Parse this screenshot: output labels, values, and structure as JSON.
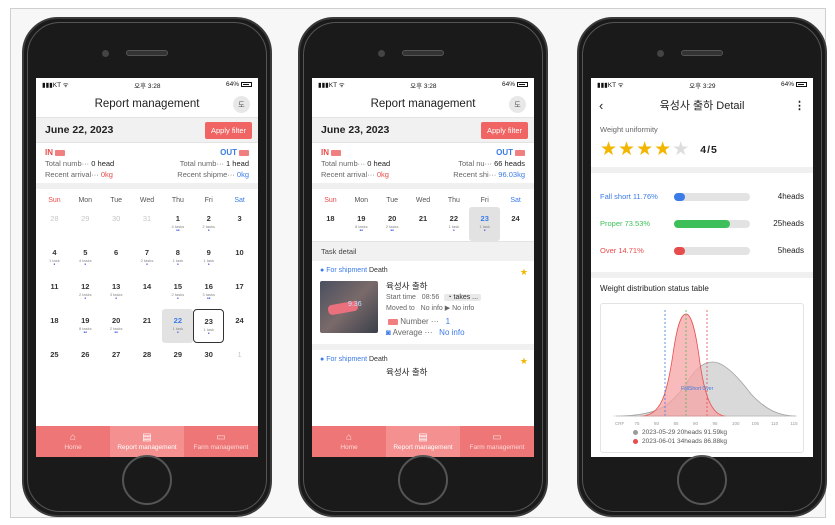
{
  "status": {
    "carrier": "KT",
    "time1": "오후 3:28",
    "time2": "오후 3:28",
    "time3": "오후 3:29",
    "battery": "64%"
  },
  "screen1": {
    "title": "Report management",
    "avatar": "도",
    "date": "June 22, 2023",
    "filter_label": "Apply filter",
    "in_label": "IN",
    "out_label": "OUT",
    "row1_l_label": "Total numb···",
    "row1_l_val": "0 head",
    "row1_r_label": "Total numb···",
    "row1_r_val": "1 head",
    "row2_l_label": "Recent arrival···",
    "row2_l_val": "0kg",
    "row2_r_label": "Recent shipme···",
    "row2_r_val": "0kg",
    "weekdays": [
      "Sun",
      "Mon",
      "Tue",
      "Wed",
      "Thu",
      "Fri",
      "Sat"
    ],
    "days": [
      {
        "d": "28",
        "m": true
      },
      {
        "d": "29",
        "m": true
      },
      {
        "d": "30",
        "m": true
      },
      {
        "d": "31",
        "m": true
      },
      {
        "d": "1",
        "t": "4 tasks",
        "dots": "••"
      },
      {
        "d": "2",
        "t": "2 tasks",
        "dots": "•"
      },
      {
        "d": "3"
      },
      {
        "d": "4",
        "t": "1 task",
        "dots": "•"
      },
      {
        "d": "5",
        "t": "4 tasks",
        "dots": "•"
      },
      {
        "d": "6"
      },
      {
        "d": "7",
        "t": "2 tasks",
        "dots": "•"
      },
      {
        "d": "8",
        "t": "1 task",
        "dots": "•"
      },
      {
        "d": "9",
        "t": "1 task",
        "dots": "•"
      },
      {
        "d": "10"
      },
      {
        "d": "11"
      },
      {
        "d": "12",
        "t": "2 tasks",
        "dots": "•"
      },
      {
        "d": "13",
        "t": "3 tasks",
        "dots": "•"
      },
      {
        "d": "14"
      },
      {
        "d": "15",
        "t": "2 tasks",
        "dots": "•"
      },
      {
        "d": "16",
        "t": "3 tasks",
        "dots": "••"
      },
      {
        "d": "17"
      },
      {
        "d": "18"
      },
      {
        "d": "19",
        "t": "8 tasks",
        "dots": "••"
      },
      {
        "d": "20",
        "t": "2 tasks",
        "dots": "••"
      },
      {
        "d": "21"
      },
      {
        "d": "22",
        "t": "1 task",
        "dots": "•",
        "sel": true
      },
      {
        "d": "23",
        "t": "1 task",
        "dots": "•",
        "box": true
      },
      {
        "d": "24"
      },
      {
        "d": "25"
      },
      {
        "d": "26"
      },
      {
        "d": "27"
      },
      {
        "d": "28"
      },
      {
        "d": "29"
      },
      {
        "d": "30"
      },
      {
        "d": "1",
        "m": true
      }
    ]
  },
  "screen2": {
    "title": "Report management",
    "avatar": "도",
    "date": "June 23, 2023",
    "filter_label": "Apply filter",
    "in_label": "IN",
    "out_label": "OUT",
    "row1_l_label": "Total numb···",
    "row1_l_val": "0 head",
    "row1_r_label": "Total nu···",
    "row1_r_val": "66 heads",
    "row2_l_label": "Recent arrival···",
    "row2_l_val": "0kg",
    "row2_r_label": "Recent shi···",
    "row2_r_val": "96.03kg",
    "weekdays": [
      "Sun",
      "Mon",
      "Tue",
      "Wed",
      "Thu",
      "Fri",
      "Sat"
    ],
    "week": [
      {
        "d": "18"
      },
      {
        "d": "19",
        "t": "8 tasks",
        "dots": "••"
      },
      {
        "d": "20",
        "t": "2 tasks",
        "dots": "••"
      },
      {
        "d": "21"
      },
      {
        "d": "22",
        "t": "1 task",
        "dots": "•"
      },
      {
        "d": "23",
        "t": "1 task",
        "dots": "•",
        "sel": true
      },
      {
        "d": "24"
      }
    ],
    "task_section": "Task detail",
    "task1": {
      "type": "For shipment",
      "kind": "Death",
      "name": "육성사 출하",
      "start_label": "Start time",
      "start_val": "08:56",
      "takes": "◔ takes ...",
      "moved": "Moved to",
      "moved_val": "No info ▶ No info",
      "number_label": "Number ···",
      "number_val": "1",
      "avg_label": "Average ···",
      "avg_val": "No info",
      "thumb_text": "9.36"
    },
    "task2": {
      "type": "For shipment",
      "kind": "Death",
      "name": "육성사 출하"
    }
  },
  "screen3": {
    "title": "육성사 출하 Detail",
    "wu_label": "Weight uniformity",
    "rating": 4,
    "rating_text": "4/5",
    "bars": [
      {
        "label": "Fall short",
        "pct": "11.76%",
        "value": 0.1176,
        "heads": "4heads",
        "color": "#3b7be8"
      },
      {
        "label": "Proper",
        "pct": "73.53%",
        "value": 0.7353,
        "heads": "25heads",
        "color": "#3fbf5a"
      },
      {
        "label": "Over",
        "pct": "14.71%",
        "value": 0.1471,
        "heads": "5heads",
        "color": "#e74c4c"
      }
    ],
    "dist_label": "Weight distribution status table",
    "chart_caption": "FallShort Over",
    "xticks": [
      "CRF",
      "75",
      "80",
      "85",
      "90",
      "95",
      "100",
      "105",
      "110",
      "115"
    ],
    "legend": [
      "2023-05-29 20heads 91.59kg",
      "2023-06-01 34heads 86.88kg"
    ],
    "legend_colors": [
      "#9a9a9a",
      "#e74c4c"
    ]
  },
  "tabbar": {
    "home": "Home",
    "report": "Report management",
    "farm": "Farm management"
  }
}
